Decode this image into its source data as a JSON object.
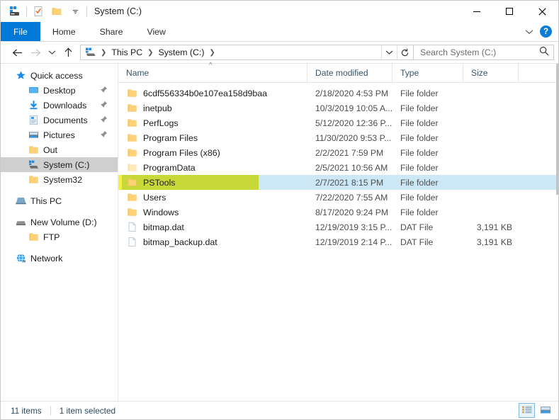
{
  "window": {
    "title": "System (C:)",
    "quick_access_toolbar": [
      {
        "name": "drive-icon",
        "label": "System (C:)"
      },
      {
        "name": "properties-icon",
        "label": "Properties"
      },
      {
        "name": "new-folder-icon",
        "label": "New folder"
      },
      {
        "name": "customize-chevron-icon",
        "label": "Customize Quick Access Toolbar"
      }
    ],
    "controls": {
      "minimize": "Minimize",
      "maximize": "Maximize",
      "close": "Close"
    }
  },
  "ribbon": {
    "tabs": [
      {
        "label": "File",
        "active": true
      },
      {
        "label": "Home",
        "active": false
      },
      {
        "label": "Share",
        "active": false
      },
      {
        "label": "View",
        "active": false
      }
    ],
    "expand_label": "Expand the Ribbon",
    "help_label": "?"
  },
  "address": {
    "back": "←",
    "forward": "→",
    "recent": "⌄",
    "up": "↑",
    "crumbs": [
      "This PC",
      "System (C:)"
    ],
    "dropdown": "⌄",
    "refresh": "↻"
  },
  "search": {
    "placeholder": "Search System (C:)",
    "icon": "search-icon"
  },
  "sidebar": {
    "items": [
      {
        "label": "Quick access",
        "icon": "star-icon",
        "level": 0,
        "pinned": false,
        "selected": false
      },
      {
        "label": "Desktop",
        "icon": "desktop-icon",
        "level": 1,
        "pinned": true,
        "selected": false
      },
      {
        "label": "Downloads",
        "icon": "downloads-icon",
        "level": 1,
        "pinned": true,
        "selected": false
      },
      {
        "label": "Documents",
        "icon": "documents-icon",
        "level": 1,
        "pinned": true,
        "selected": false
      },
      {
        "label": "Pictures",
        "icon": "pictures-icon",
        "level": 1,
        "pinned": true,
        "selected": false
      },
      {
        "label": "Out",
        "icon": "folder-icon",
        "level": 1,
        "pinned": false,
        "selected": false
      },
      {
        "label": "System (C:)",
        "icon": "drive-icon",
        "level": 1,
        "pinned": false,
        "selected": true
      },
      {
        "label": "System32",
        "icon": "folder-icon",
        "level": 1,
        "pinned": false,
        "selected": false
      },
      {
        "gap": true
      },
      {
        "label": "This PC",
        "icon": "pc-icon",
        "level": 0,
        "pinned": false,
        "selected": false
      },
      {
        "gap": true
      },
      {
        "label": "New Volume (D:)",
        "icon": "volume-icon",
        "level": 0,
        "pinned": false,
        "selected": false
      },
      {
        "label": "FTP",
        "icon": "folder-icon",
        "level": 1,
        "pinned": false,
        "selected": false
      },
      {
        "gap": true
      },
      {
        "label": "Network",
        "icon": "network-icon",
        "level": 0,
        "pinned": false,
        "selected": false
      }
    ]
  },
  "filelist": {
    "columns": [
      {
        "label": "Name",
        "sorted": "asc"
      },
      {
        "label": "Date modified",
        "sorted": ""
      },
      {
        "label": "Type",
        "sorted": ""
      },
      {
        "label": "Size",
        "sorted": ""
      }
    ],
    "rows": [
      {
        "name": "6cdf556334b0e107ea158d9baa",
        "date": "2/18/2020 4:53 PM",
        "type": "File folder",
        "size": "",
        "icon": "folder-icon",
        "selected": false,
        "highlighted": false,
        "dim": false
      },
      {
        "name": "inetpub",
        "date": "10/3/2019 10:05 A...",
        "type": "File folder",
        "size": "",
        "icon": "folder-icon",
        "selected": false,
        "highlighted": false,
        "dim": false
      },
      {
        "name": "PerfLogs",
        "date": "5/12/2020 12:36 P...",
        "type": "File folder",
        "size": "",
        "icon": "folder-icon",
        "selected": false,
        "highlighted": false,
        "dim": false
      },
      {
        "name": "Program Files",
        "date": "11/30/2020 9:53 P...",
        "type": "File folder",
        "size": "",
        "icon": "folder-icon",
        "selected": false,
        "highlighted": false,
        "dim": false
      },
      {
        "name": "Program Files (x86)",
        "date": "2/2/2021 7:59 PM",
        "type": "File folder",
        "size": "",
        "icon": "folder-icon",
        "selected": false,
        "highlighted": false,
        "dim": false
      },
      {
        "name": "ProgramData",
        "date": "2/5/2021 10:56 AM",
        "type": "File folder",
        "size": "",
        "icon": "folder-icon",
        "selected": false,
        "highlighted": false,
        "dim": true
      },
      {
        "name": "PSTools",
        "date": "2/7/2021 8:15 PM",
        "type": "File folder",
        "size": "",
        "icon": "folder-icon",
        "selected": true,
        "highlighted": true,
        "dim": false
      },
      {
        "name": "Users",
        "date": "7/22/2020 7:55 AM",
        "type": "File folder",
        "size": "",
        "icon": "folder-icon",
        "selected": false,
        "highlighted": false,
        "dim": false
      },
      {
        "name": "Windows",
        "date": "8/17/2020 9:24 PM",
        "type": "File folder",
        "size": "",
        "icon": "folder-icon",
        "selected": false,
        "highlighted": false,
        "dim": false
      },
      {
        "name": "bitmap.dat",
        "date": "12/19/2019 3:15 P...",
        "type": "DAT File",
        "size": "3,191 KB",
        "icon": "file-icon",
        "selected": false,
        "highlighted": false,
        "dim": false
      },
      {
        "name": "bitmap_backup.dat",
        "date": "12/19/2019 2:14 P...",
        "type": "DAT File",
        "size": "3,191 KB",
        "icon": "file-icon",
        "selected": false,
        "highlighted": false,
        "dim": false
      }
    ]
  },
  "status": {
    "item_count": "11 items",
    "selection": "1 item selected",
    "views": [
      {
        "name": "details-view-button",
        "active": true
      },
      {
        "name": "large-icons-view-button",
        "active": false
      }
    ]
  },
  "colors": {
    "accent": "#0078d7",
    "selection": "#cce8f7",
    "highlight": "#c7d838",
    "highlight_edge": "#f2f23a",
    "folder": "#ffd277"
  }
}
